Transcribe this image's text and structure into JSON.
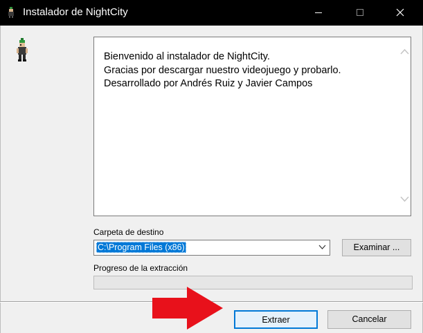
{
  "window": {
    "title": "Instalador de NightCity",
    "controls": {
      "minimize_icon": "minimize-icon",
      "maximize_icon": "maximize-icon",
      "close_icon": "close-icon"
    }
  },
  "welcome": {
    "lines": [
      "Bienvenido al instalador de NightCity.",
      "Gracias por descargar nuestro videojuego y probarlo.",
      "Desarrollado por Andrés Ruiz y Javier Campos"
    ]
  },
  "destination": {
    "label": "Carpeta de destino",
    "value": "C:\\Program Files (x86)",
    "browse_label": "Examinar ..."
  },
  "progress": {
    "label": "Progreso de la extracción",
    "fraction": 0
  },
  "actions": {
    "extract_label": "Extraer",
    "cancel_label": "Cancelar"
  },
  "colors": {
    "titlebar": "#000000",
    "selection": "#0078d7",
    "annotation_arrow": "#e8111b"
  }
}
